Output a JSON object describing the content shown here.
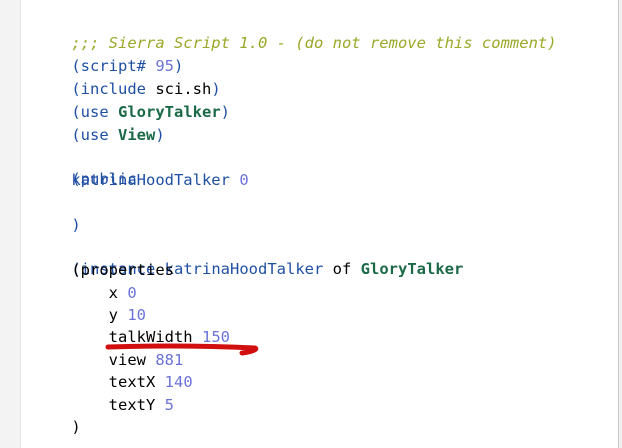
{
  "editor": {
    "comment_line": ";;; Sierra Script 1.0 - (do not remove this comment)",
    "paren_open": "(",
    "paren_close": ")",
    "kw_script": "script#",
    "num_95": "95",
    "kw_include": "include",
    "include_target": "sci.sh",
    "kw_use": "use",
    "cls_glorytalker": "GloryTalker",
    "cls_view": "View",
    "kw_public": "public",
    "pub_name": "katrinaHoodTalker",
    "num_0": "0",
    "kw_instance": "instance",
    "of_text": "of",
    "kw_properties": "properties",
    "props": [
      {
        "name": "x",
        "value": "0"
      },
      {
        "name": "y",
        "value": "10"
      },
      {
        "name": "talkWidth",
        "value": "150"
      },
      {
        "name": "view",
        "value": "881"
      },
      {
        "name": "textX",
        "value": "140"
      },
      {
        "name": "textY",
        "value": "5"
      }
    ]
  },
  "annotation": {
    "color": "#d10f0f",
    "target": "talkWidth 150"
  }
}
